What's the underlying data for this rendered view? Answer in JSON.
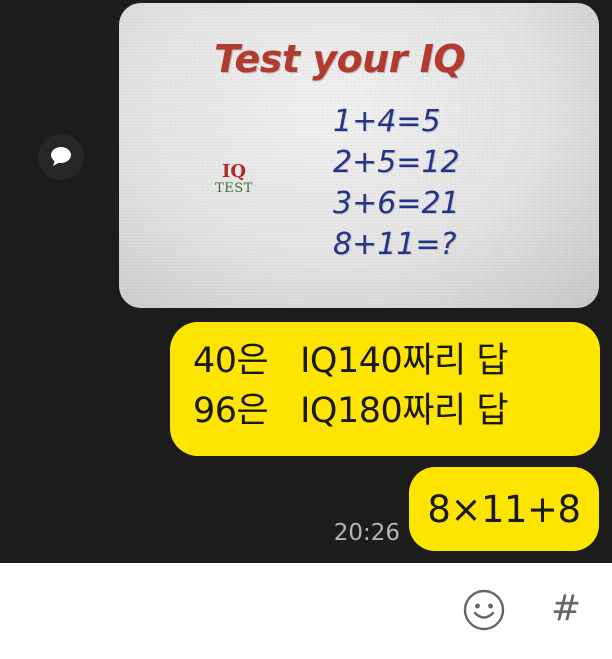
{
  "message_image": {
    "title": "Test your IQ",
    "equations": [
      "1+4=5",
      "2+5=12",
      "3+6=21",
      "8+11=?"
    ],
    "logo_top": "IQ",
    "logo_bottom": "TEST"
  },
  "messages": {
    "reply_line_1": "40은   IQ140짜리 답",
    "reply_line_2": "96은   IQ180짜리 답",
    "reply_answer": "8×11+8",
    "timestamp": "20:26"
  },
  "input_bar": {
    "hash_label": "#"
  },
  "icons": {
    "share": "share-icon",
    "emoji": "emoji-icon"
  },
  "colors": {
    "chat_background": "#1c1c1c",
    "bubble": "#fee500",
    "title_red": "#b33a2e",
    "equation_blue": "#23348a"
  }
}
